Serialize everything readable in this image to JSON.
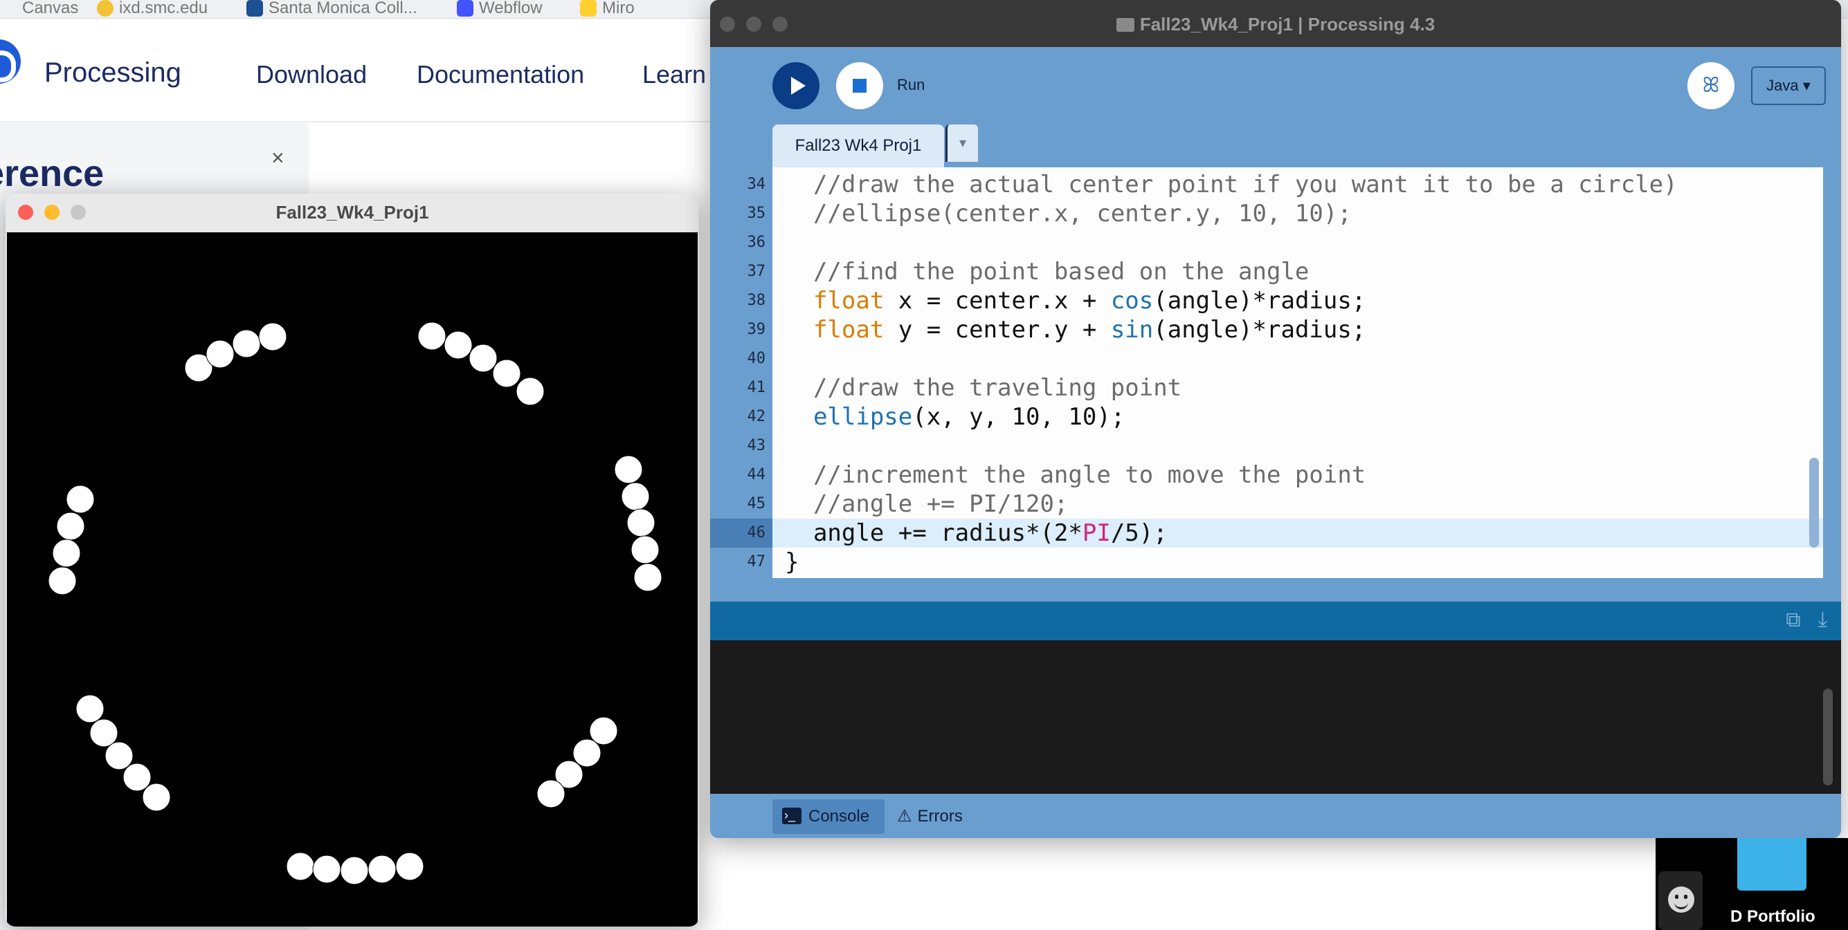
{
  "bookmarks": [
    {
      "label": "Canvas",
      "icon": "canvas-icon"
    },
    {
      "label": "ixd.smc.edu",
      "icon": "ixd-icon"
    },
    {
      "label": "Santa Monica Coll...",
      "icon": "smc-icon"
    },
    {
      "label": "Webflow",
      "icon": "webflow-icon"
    },
    {
      "label": "Miro",
      "icon": "miro-icon"
    }
  ],
  "site": {
    "brand": "Processing",
    "nav": [
      "Download",
      "Documentation",
      "Learn"
    ],
    "reference_title": "erence",
    "close": "×"
  },
  "sketch": {
    "title": "Fall23_Wk4_Proj1",
    "background": "#000000",
    "dot_color": "#ffffff"
  },
  "ide": {
    "title": "Fall23_Wk4_Proj1 | Processing 4.3",
    "run_label": "Run",
    "mode": "Java ▾",
    "tab": "Fall23 Wk4 Proj1",
    "tab_arrow": "▾",
    "debug_icon": "butterfly-icon",
    "code": [
      {
        "ln": "34",
        "parts": [
          {
            "t": "  //draw the actual center point if you want it to be a circle)",
            "c": "cmt"
          }
        ]
      },
      {
        "ln": "35",
        "parts": [
          {
            "t": "  //ellipse(center.x, center.y, 10, 10);",
            "c": "cmt"
          }
        ]
      },
      {
        "ln": "36",
        "parts": []
      },
      {
        "ln": "37",
        "parts": [
          {
            "t": "  //find the point based on the angle",
            "c": "cmt"
          }
        ]
      },
      {
        "ln": "38",
        "parts": [
          {
            "t": "  ",
            "c": ""
          },
          {
            "t": "float",
            "c": "kw"
          },
          {
            "t": " x = center.x + ",
            "c": ""
          },
          {
            "t": "cos",
            "c": "fn"
          },
          {
            "t": "(angle)*radius;",
            "c": ""
          }
        ]
      },
      {
        "ln": "39",
        "parts": [
          {
            "t": "  ",
            "c": ""
          },
          {
            "t": "float",
            "c": "kw"
          },
          {
            "t": " y = center.y + ",
            "c": ""
          },
          {
            "t": "sin",
            "c": "fn"
          },
          {
            "t": "(angle)*radius;",
            "c": ""
          }
        ]
      },
      {
        "ln": "40",
        "parts": []
      },
      {
        "ln": "41",
        "parts": [
          {
            "t": "  //draw the traveling point",
            "c": "cmt"
          }
        ]
      },
      {
        "ln": "42",
        "parts": [
          {
            "t": "  ",
            "c": ""
          },
          {
            "t": "ellipse",
            "c": "fn"
          },
          {
            "t": "(x, y, 10, 10);",
            "c": ""
          }
        ]
      },
      {
        "ln": "43",
        "parts": []
      },
      {
        "ln": "44",
        "parts": [
          {
            "t": "  //increment the angle to move the point",
            "c": "cmt"
          }
        ]
      },
      {
        "ln": "45",
        "parts": [
          {
            "t": "  //angle += PI/120;",
            "c": "cmt"
          }
        ]
      },
      {
        "ln": "46",
        "parts": [
          {
            "t": "  angle += radius*(2*",
            "c": ""
          },
          {
            "t": "PI",
            "c": "cst"
          },
          {
            "t": "/5);",
            "c": ""
          }
        ],
        "current": true
      },
      {
        "ln": "47",
        "parts": [
          {
            "t": "}",
            "c": ""
          }
        ]
      }
    ],
    "footer": {
      "console": "Console",
      "errors": "Errors"
    }
  },
  "dock": {
    "portfolio_label": "D Portfolio"
  }
}
